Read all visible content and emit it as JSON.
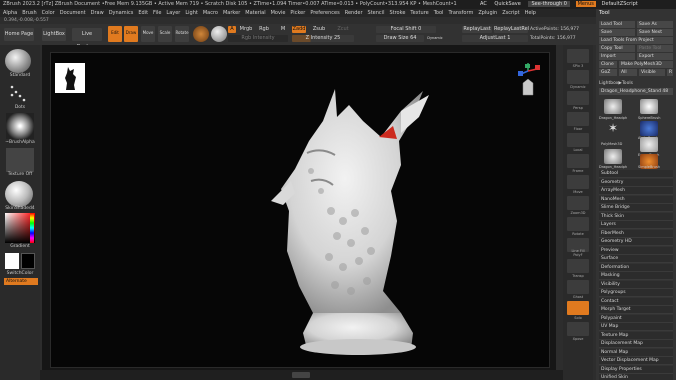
{
  "topbar": {
    "title": "ZBrush 2023.2 [rTz]  ZBrush Document   •Free Mem 9.135GB • Active Mem 719 • Scratch Disk 105 • ZTime•1.094 Timer•0.007 ATime•0.013 • PolyCount•313.954 KP • MeshCount•1",
    "ac": "AC",
    "quicksave": "QuickSave",
    "seethrough": "See-through 0",
    "menus": "Menus",
    "default_script": "DefaultZScript"
  },
  "menus": [
    "Alpha",
    "Brush",
    "Color",
    "Document",
    "Draw",
    "Dynamics",
    "Edit",
    "File",
    "Layer",
    "Light",
    "Macro",
    "Marker",
    "Material",
    "Movie",
    "Picker",
    "Preferences",
    "Render",
    "Stencil",
    "Stroke",
    "Texture",
    "Tool",
    "Transform",
    "Zplugin",
    "Zscript",
    "Help"
  ],
  "coords": "0.394,-0.008,-0.557",
  "toolrow": {
    "home": "Home Page",
    "lightbox": "LightBox",
    "live_boolean": "Live Boolean",
    "edit": "Edit",
    "draw": "Draw",
    "move": "Move",
    "scale": "Scale",
    "rotate": "Rotate",
    "a": "A",
    "mrgb": "Mrgb",
    "rgb": "Rgb",
    "m": "M",
    "rgb_intensity": "Rgb Intensity",
    "zadd": "Zadd",
    "zsub": "Zsub",
    "zcut": "Zcut",
    "z_intensity": "Z Intensity 25",
    "focal_shift": "Focal Shift 0",
    "draw_size": "Draw Size 64",
    "dynamic": "Dynamic",
    "replay_last": "ReplayLast",
    "replay_last_rel": "ReplayLastRel",
    "active_points": "ActivePoints: 156,977",
    "adjust_last": "AdjustLast 1",
    "total_points": "TotalPoints: 156,977"
  },
  "left": {
    "standard": "Standard",
    "dots": "Dots",
    "brush_alpha": "~BrushAlpha",
    "texture_off": "Texture Off",
    "skin_shaded": "SkinShaded4",
    "gradient": "Gradient",
    "switch_color": "SwitchColor",
    "alternate": "Alternate"
  },
  "right_shelf": [
    "SPix 3",
    "Dynamic",
    "Persp",
    "Floor",
    "Local",
    "Frame",
    "Move",
    "Zoom3D",
    "Rotate",
    "Line Fill PolyF",
    "Transp",
    "Ghost",
    "Solo",
    "Xpose"
  ],
  "tray": {
    "title": "Tool",
    "buttons": [
      "Load Tool",
      "Save As",
      "Save",
      "Save Next",
      "Load Tools From Project",
      "Copy Tool",
      "Paste Tool",
      "Import",
      "Export",
      "Clone",
      "Make PolyMesh3D",
      "GoZ",
      "All",
      "Visible",
      "R"
    ],
    "lightbox_tools": "Lightbox▶Tools",
    "current_tool": "Dragon_Headphone_Stand 48",
    "tools": [
      "Dragon_Headph",
      "SphereBrush",
      "AlphaBrush",
      "PolyMesh3D",
      "EraserBrush",
      "Dragon_Headph",
      "SimpleBrush"
    ],
    "subpalettes": [
      "Subtool",
      "Geometry",
      "ArrayMesh",
      "NanoMesh",
      "Slime Bridge",
      "Thick Skin",
      "Layers",
      "FiberMesh",
      "Geometry HD",
      "Preview",
      "Surface",
      "Deformation",
      "Masking",
      "Visibility",
      "Polygroups",
      "Contact",
      "Morph Target",
      "Polypaint",
      "UV Map",
      "Texture Map",
      "Displacement Map",
      "Normal Map",
      "Vector Displacement Map",
      "Display Properties",
      "Unified Skin"
    ]
  },
  "colors": {
    "accent": "#e07a1f",
    "bg": "#2d2d2d",
    "viewport": "#060606"
  }
}
